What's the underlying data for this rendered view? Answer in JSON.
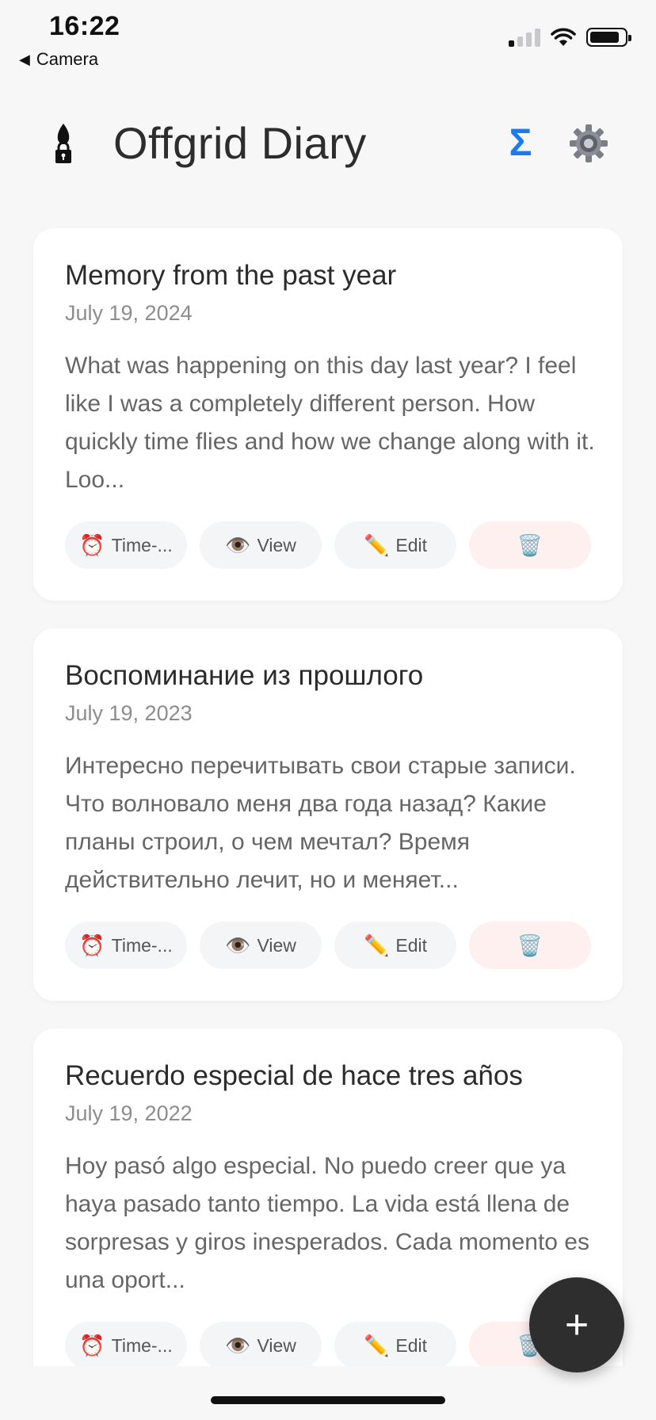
{
  "status_bar": {
    "time": "16:22",
    "back_label": "Camera",
    "signal_bars_active": 1,
    "signal_bars_total": 4,
    "battery_level": 0.85
  },
  "header": {
    "app_title": "Offgrid Diary",
    "stats_symbol": "Σ",
    "lock_icon": "ink-pen-lock-icon",
    "settings_icon": "gear-icon",
    "accent_color": "#1a7cf2"
  },
  "entries": [
    {
      "title": "Memory from the past year",
      "date": "July 19, 2024",
      "excerpt": "What was happening on this day last year? I feel like I was a completely different person. How quickly time flies and how we change along with it. Loo..."
    },
    {
      "title": "Воспоминание из прошлого",
      "date": "July 19, 2023",
      "excerpt": "Интересно перечитывать свои старые записи. Что волновало меня два года назад? Какие планы строил, о чем мечтал? Время действительно лечит, но и меняет..."
    },
    {
      "title": "Recuerdo especial de hace tres años",
      "date": "July 19, 2022",
      "excerpt": "Hoy pasó algo especial. No puedo creer que ya haya pasado tanto tiempo. La vida está llena de sorpresas y giros inesperados. Cada momento es una oport..."
    }
  ],
  "actions": {
    "time_label": "Time-...",
    "time_icon": "⏰",
    "view_label": "View",
    "view_icon": "👁️",
    "edit_label": "Edit",
    "edit_icon": "✏️",
    "delete_icon": "🗑️"
  },
  "fab": {
    "symbol": "+"
  }
}
